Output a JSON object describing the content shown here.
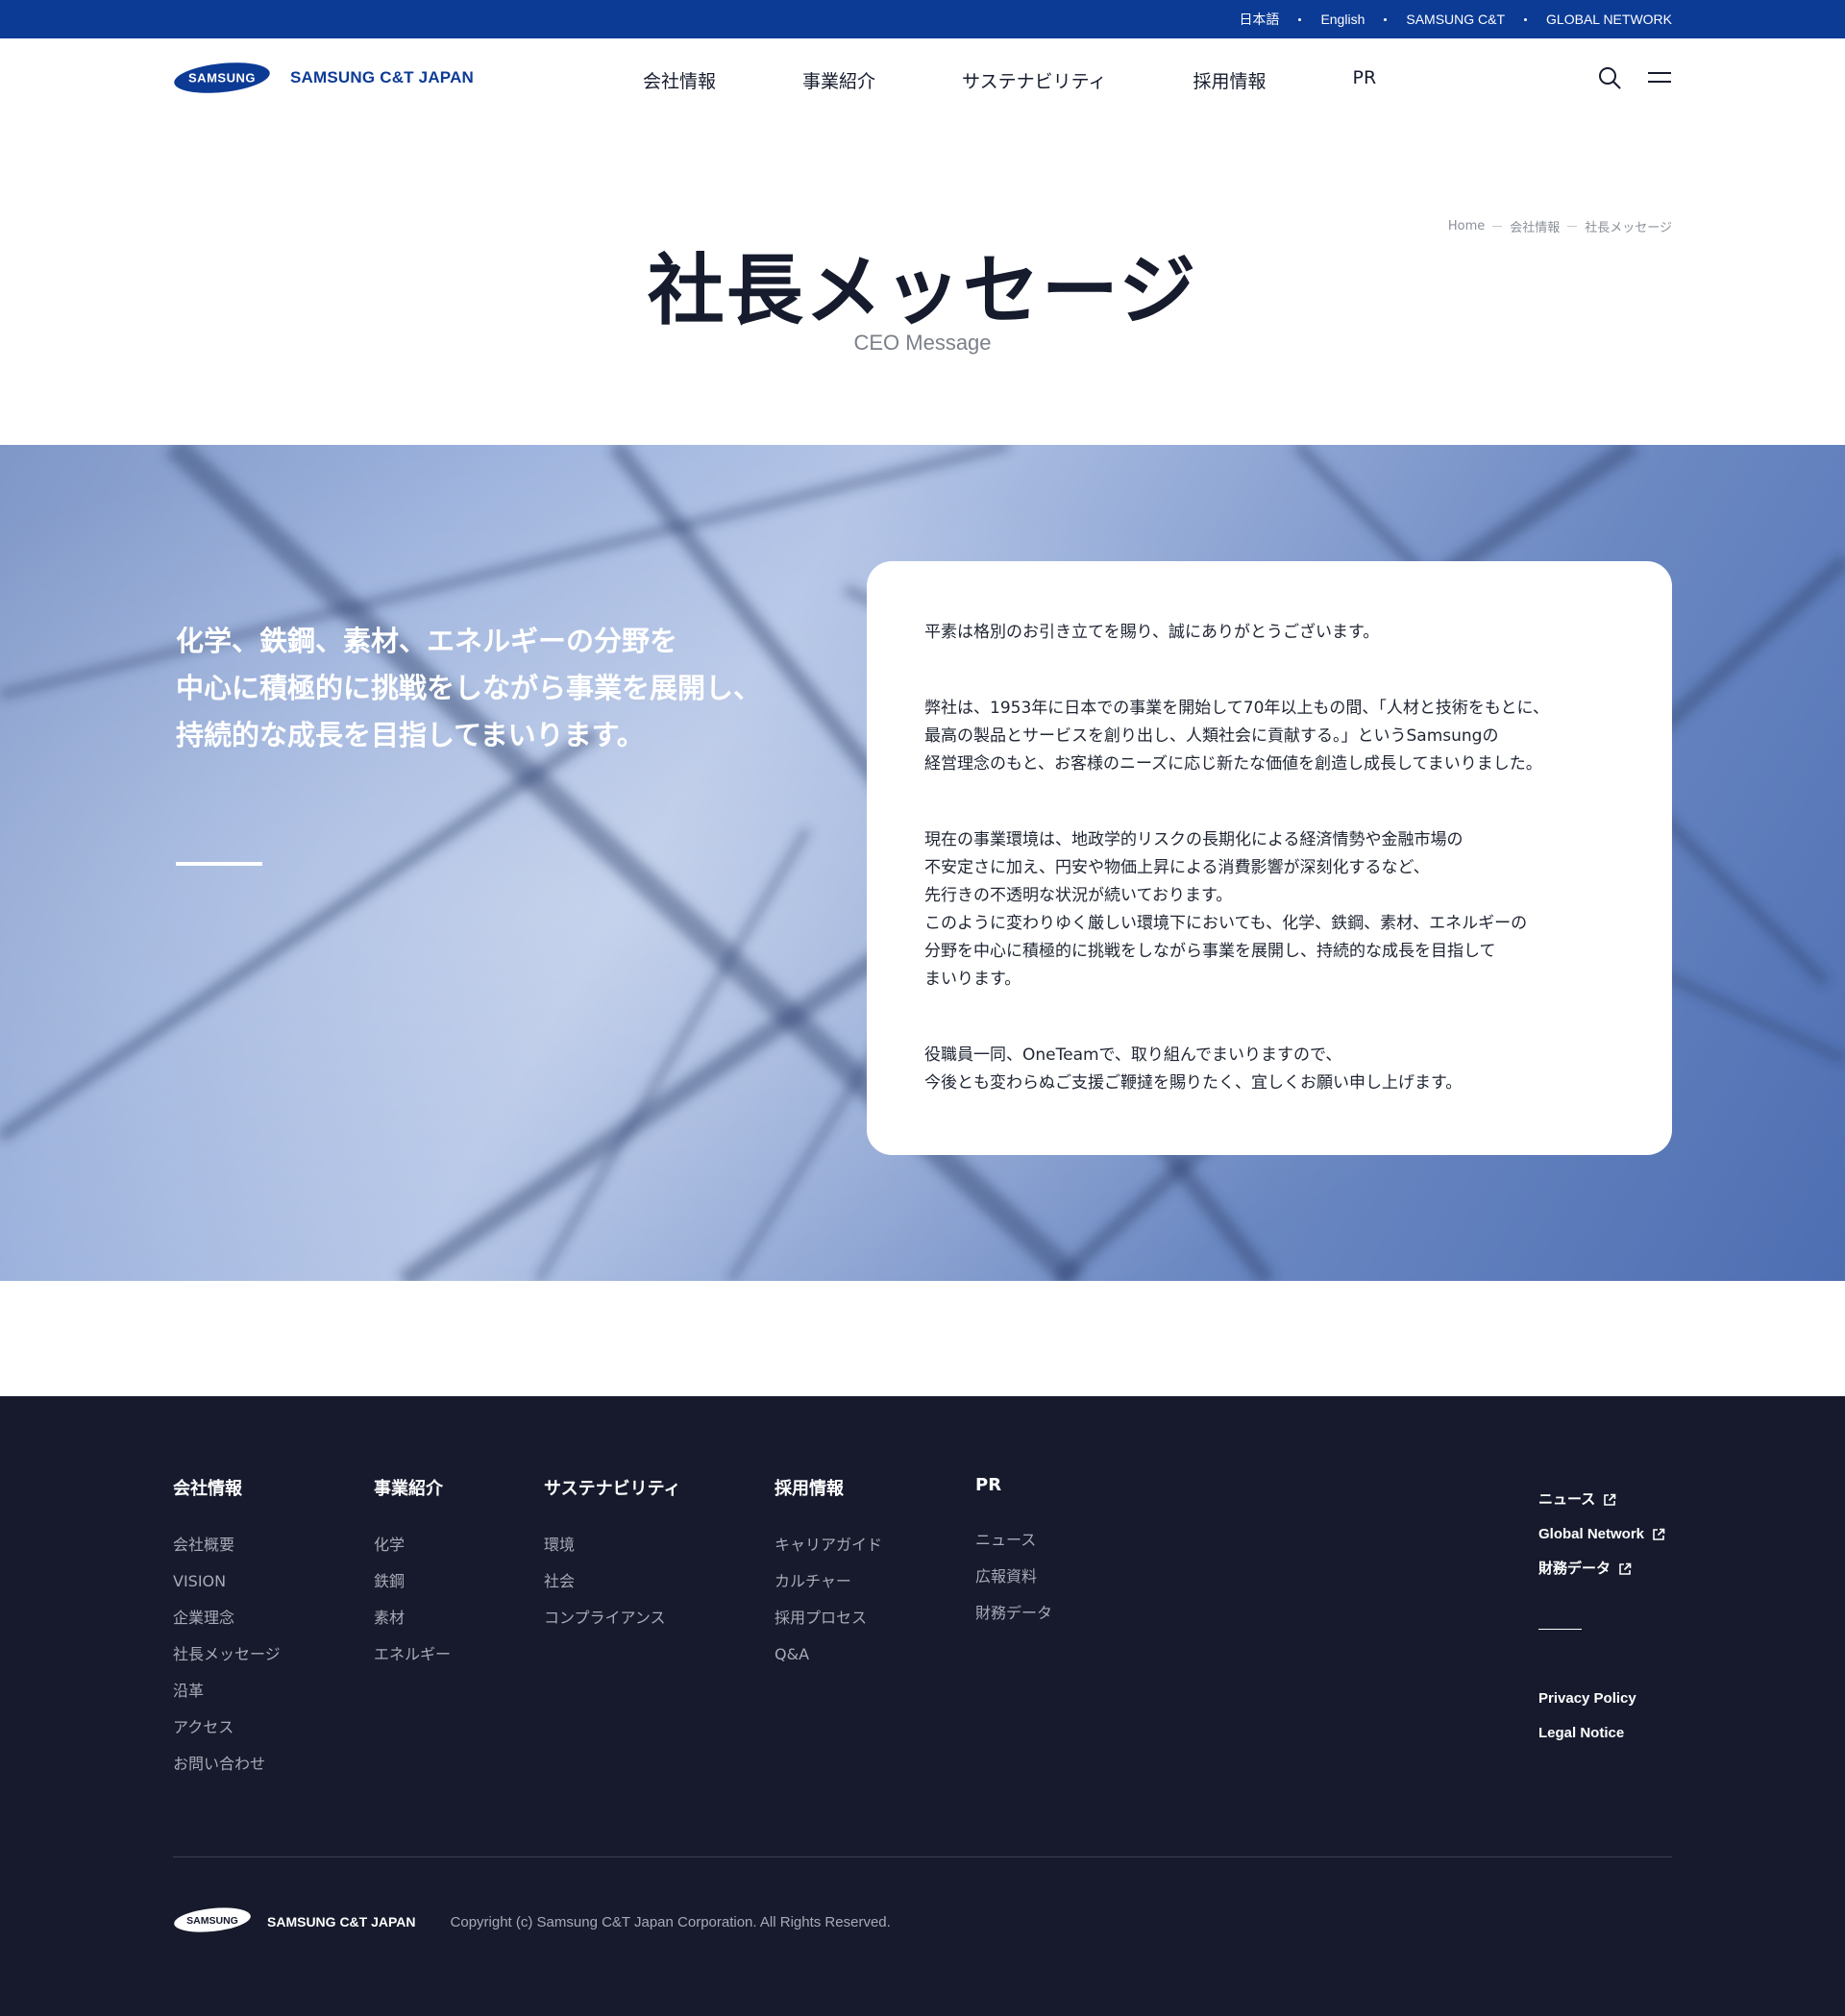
{
  "utility_bar": {
    "links": [
      "日本語",
      "English",
      "SAMSUNG C&T",
      "GLOBAL NETWORK"
    ],
    "background": "#0c3b96"
  },
  "header": {
    "logo_wordmark": "SAMSUNG",
    "logo_text": "SAMSUNG C&T JAPAN",
    "nav": [
      "会社情報",
      "事業紹介",
      "サステナビリティ",
      "採用情報",
      "PR"
    ],
    "icons": [
      "search-icon",
      "menu-icon"
    ]
  },
  "breadcrumb": [
    "Home",
    "会社情報",
    "社長メッセージ"
  ],
  "page": {
    "title": "社長メッセージ",
    "subtitle": "CEO Message"
  },
  "hero": {
    "quote_lines": [
      "化学、鉄鋼、素材、エネルギーの分野を",
      "中心に積極的に挑戦をしながら事業を展開し、",
      "持続的な成長を目指してまいります。"
    ]
  },
  "message": {
    "paragraphs": [
      [
        "平素は格別のお引き立てを賜り、誠にありがとうございます。"
      ],
      [
        "弊社は、1953年に日本での事業を開始して70年以上もの間、「人材と技術をもとに、",
        "最高の製品とサービスを創り出し、人類社会に貢献する。」というSamsungの",
        "経営理念のもと、お客様のニーズに応じ新たな価値を創造し成長してまいりました。"
      ],
      [
        "現在の事業環境は、地政学的リスクの長期化による経済情勢や金融市場の",
        "不安定さに加え、円安や物価上昇による消費影響が深刻化するなど、",
        "先行きの不透明な状況が続いております。",
        "このように変わりゆく厳しい環境下においても、化学、鉄鋼、素材、エネルギーの",
        "分野を中心に積極的に挑戦をしながら事業を展開し、持続的な成長を目指して",
        "まいります。"
      ],
      [
        "役職員一同、OneTeamで、取り組んでまいりますので、",
        "今後とも変わらぬご支援ご鞭撻を賜りたく、宜しくお願い申し上げます。"
      ]
    ]
  },
  "footer": {
    "columns": [
      {
        "title": "会社情報",
        "items": [
          "会社概要",
          "VISION",
          "企業理念",
          "社長メッセージ",
          "沿革",
          "アクセス",
          "お問い合わせ"
        ]
      },
      {
        "title": "事業紹介",
        "items": [
          "化学",
          "鉄鋼",
          "素材",
          "エネルギー"
        ]
      },
      {
        "title": "サステナビリティ",
        "items": [
          "環境",
          "社会",
          "コンプライアンス"
        ]
      },
      {
        "title": "採用情報",
        "items": [
          "キャリアガイド",
          "カルチャー",
          "採用プロセス",
          "Q&A"
        ]
      },
      {
        "title": "PR",
        "items": [
          "ニュース",
          "広報資料",
          "財務データ"
        ]
      }
    ],
    "external_links": [
      "ニュース",
      "Global Network",
      "財務データ"
    ],
    "policy_links": [
      "Privacy Policy",
      "Legal Notice"
    ],
    "logo_wordmark": "SAMSUNG",
    "logo_text": "SAMSUNG C&T JAPAN",
    "copyright": "Copyright (c) Samsung C&T Japan Corporation. All Rights Reserved.",
    "background": "#161a2c"
  }
}
